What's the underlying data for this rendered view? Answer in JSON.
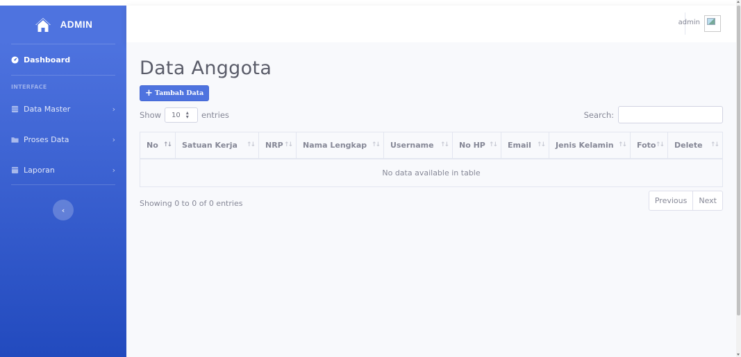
{
  "brand": {
    "text": "ADMIN",
    "icon": "house-icon"
  },
  "sidebar": {
    "dashboard": {
      "label": "Dashboard",
      "icon": "tachometer-icon"
    },
    "heading": "INTERFACE",
    "items": [
      {
        "label": "Data Master",
        "icon": "database-icon"
      },
      {
        "label": "Proses Data",
        "icon": "folder-icon"
      },
      {
        "label": "Laporan",
        "icon": "table-icon"
      }
    ],
    "toggle_glyph": "‹"
  },
  "topbar": {
    "username": "admin",
    "avatar_icon": "broken-image-icon"
  },
  "page": {
    "title": "Data Anggota",
    "add_button": "Tambah Data"
  },
  "table_controls": {
    "show_label": "Show",
    "page_length": "10",
    "entries_label": "entries",
    "search_label": "Search:",
    "search_value": ""
  },
  "table": {
    "columns": [
      "No",
      "Satuan Kerja",
      "NRP",
      "Nama Lengkap",
      "Username",
      "No HP",
      "Email",
      "Jenis Kelamin",
      "Foto",
      "Delete"
    ],
    "empty_message": "No data available in table"
  },
  "footer": {
    "info": "Showing 0 to 0 of 0 entries",
    "previous": "Previous",
    "next": "Next"
  },
  "colors": {
    "primary": "#4e73df",
    "primary_dark": "#224abe",
    "text_muted": "#858796",
    "title": "#5a5c69"
  }
}
